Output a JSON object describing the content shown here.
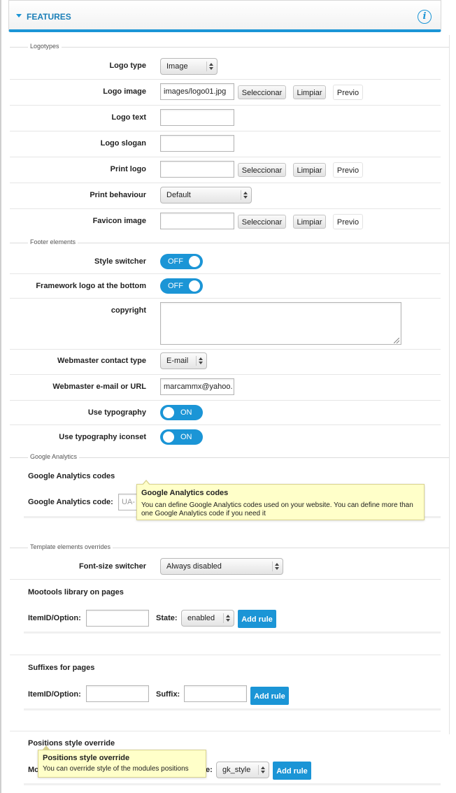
{
  "header": {
    "title": "FEATURES",
    "info_icon": "info-icon",
    "accent_color": "#1b95d6"
  },
  "sections": {
    "logotypes": "Logotypes",
    "footer": "Footer elements",
    "analytics": "Google Analytics",
    "overrides": "Template elements overrides"
  },
  "logo_type": {
    "label": "Logo type",
    "value": "Image"
  },
  "logo_image": {
    "label": "Logo image",
    "value": "images/logo01.jpg"
  },
  "logo_text": {
    "label": "Logo text",
    "value": ""
  },
  "logo_slogan": {
    "label": "Logo slogan",
    "value": ""
  },
  "print_logo": {
    "label": "Print logo",
    "value": ""
  },
  "print_behaviour": {
    "label": "Print behaviour",
    "value": "Default"
  },
  "favicon": {
    "label": "Favicon image",
    "value": ""
  },
  "buttons": {
    "select": "Seleccionar",
    "clear": "Limpiar",
    "preview": "Previo",
    "add_rule": "Add rule"
  },
  "style_switcher": {
    "label": "Style switcher",
    "state": "OFF"
  },
  "framework_logo": {
    "label": "Framework logo at the bottom",
    "state": "OFF"
  },
  "copyright": {
    "label": "copyright",
    "value": ""
  },
  "webmaster_contact": {
    "label": "Webmaster contact type",
    "value": "E-mail"
  },
  "webmaster_email": {
    "label": "Webmaster e-mail or URL",
    "value": "marcammx@yahoo."
  },
  "use_typography": {
    "label": "Use typography",
    "state": "ON"
  },
  "use_typography_iconset": {
    "label": "Use typography iconset",
    "state": "ON"
  },
  "ga": {
    "title": "Google Analytics codes",
    "code_label": "Google Analytics code:",
    "code_placeholder": "UA-",
    "tooltip_title": "Google Analytics codes",
    "tooltip_text": "You can define Google Analytics codes used on your website. You can define more than one Google Analytics code if you need it"
  },
  "font_size_switcher": {
    "label": "Font-size switcher",
    "value": "Always disabled"
  },
  "mootools": {
    "title": "Mootools library on pages",
    "itemid_label": "ItemID/Option:",
    "state_label": "State:",
    "state_value": "enabled"
  },
  "suffixes": {
    "title": "Suffixes for pages",
    "itemid_label": "ItemID/Option:",
    "suffix_label": "Suffix:"
  },
  "positions": {
    "title": "Positions style override",
    "partial_label": "Mo",
    "partial_style_label": "e:",
    "style_value": "gk_style",
    "tooltip_title": "Positions style override",
    "tooltip_text": "You can override style of the modules positions"
  }
}
